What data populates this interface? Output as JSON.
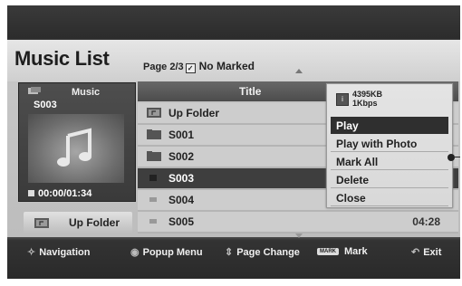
{
  "header": {
    "title": "Music List",
    "page_info": "Page 2/3",
    "marked_status": "No Marked"
  },
  "preview": {
    "type_label": "Music",
    "file_name": "S003",
    "time": "00:00/01:34"
  },
  "up_folder_button": {
    "label": "Up Folder"
  },
  "list": {
    "header": "Title",
    "rows": [
      {
        "name": "Up Folder",
        "icon": "up-folder-icon",
        "duration": ""
      },
      {
        "name": "S001",
        "icon": "folder-icon",
        "duration": ""
      },
      {
        "name": "S002",
        "icon": "folder-icon",
        "duration": ""
      },
      {
        "name": "S003",
        "icon": "music-file-icon",
        "duration": ""
      },
      {
        "name": "S004",
        "icon": "music-file-icon",
        "duration": ""
      },
      {
        "name": "S005",
        "icon": "music-file-icon",
        "duration": "04:28"
      }
    ]
  },
  "popup": {
    "file_size": "4395KB",
    "bitrate": "1Kbps",
    "items": [
      "Play",
      "Play with Photo",
      "Mark All",
      "Delete",
      "Close"
    ]
  },
  "footer": {
    "navigation": "Navigation",
    "popup_menu": "Popup Menu",
    "page_change": "Page Change",
    "mark_badge": "MARK",
    "mark": "Mark",
    "exit": "Exit"
  }
}
